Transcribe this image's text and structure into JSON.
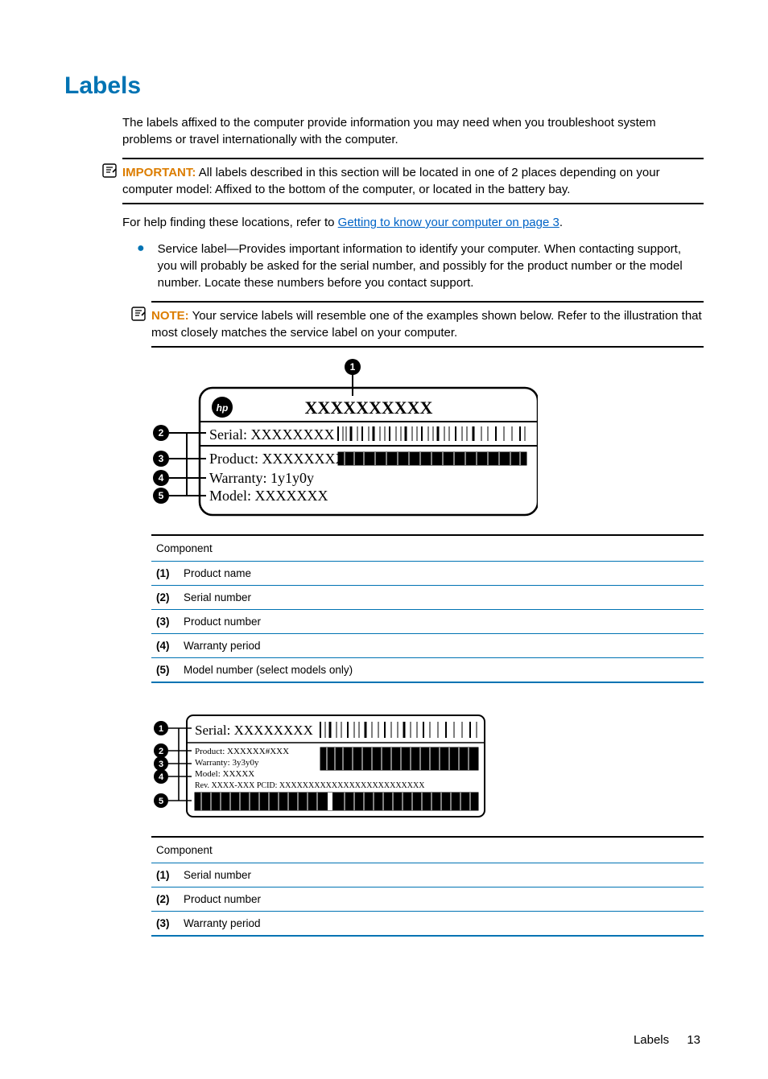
{
  "title": "Labels",
  "intro": "The labels affixed to the computer provide information you may need when you troubleshoot system problems or travel internationally with the computer.",
  "important": {
    "label": "IMPORTANT:",
    "text": "All labels described in this section will be located in one of 2 places depending on your computer model: Affixed to the bottom of the computer, or located in the battery bay."
  },
  "help_prefix": "For help finding these locations, refer to ",
  "help_link": "Getting to know your computer on page 3",
  "help_suffix": ".",
  "bullet": "Service label—Provides important information to identify your computer. When contacting support, you will probably be asked for the serial number, and possibly for the product number or the model number. Locate these numbers before you contact support.",
  "note": {
    "label": "NOTE:",
    "text": "Your service labels will resemble one of the examples shown below. Refer to the illustration that most closely matches the service label on your computer."
  },
  "diagram1": {
    "title_placeholder": "XXXXXXXXXX",
    "serial_label": "Serial:",
    "serial_value": "XXXXXXXX",
    "product_label": "Product:",
    "product_value": "XXXXXXXX",
    "warranty_label": "Warranty:",
    "warranty_value": "1y1y0y",
    "model_label": "Model:",
    "model_value": "XXXXXXX"
  },
  "table1": {
    "header": "Component",
    "rows": [
      {
        "num": "(1)",
        "text": "Product name"
      },
      {
        "num": "(2)",
        "text": "Serial number"
      },
      {
        "num": "(3)",
        "text": "Product number"
      },
      {
        "num": "(4)",
        "text": "Warranty period"
      },
      {
        "num": "(5)",
        "text": "Model number (select models only)"
      }
    ]
  },
  "diagram2": {
    "serial_label": "Serial:",
    "serial_value": "XXXXXXXX",
    "product_line": "Product: XXXXXX#XXX",
    "warranty_line": "Warranty: 3y3y0y",
    "model_line": "Model: XXXXX",
    "rev_line": "Rev. XXXX-XXX  PCID: XXXXXXXXXXXXXXXXXXXXXXXXX"
  },
  "table2": {
    "header": "Component",
    "rows": [
      {
        "num": "(1)",
        "text": "Serial number"
      },
      {
        "num": "(2)",
        "text": "Product number"
      },
      {
        "num": "(3)",
        "text": "Warranty period"
      }
    ]
  },
  "footer": {
    "section": "Labels",
    "page": "13"
  }
}
